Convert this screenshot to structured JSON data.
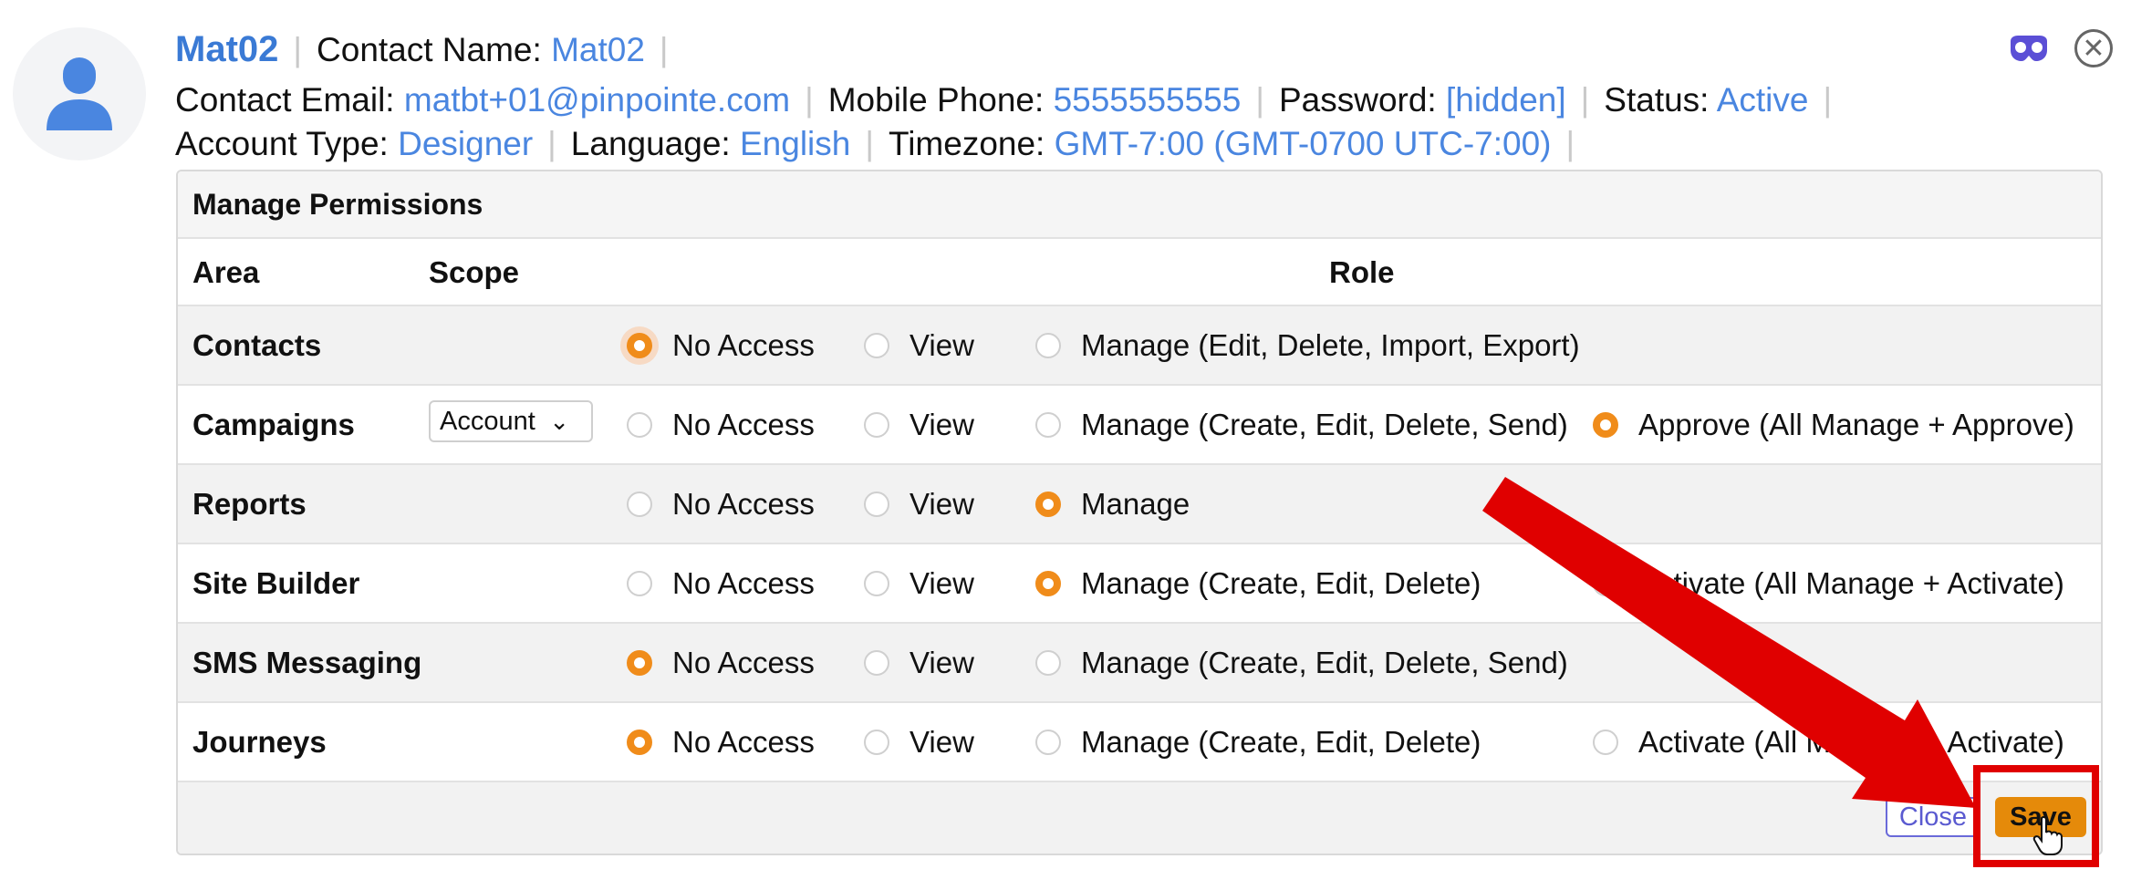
{
  "header": {
    "name": "Mat02",
    "separator": "|",
    "fields_line1": [
      {
        "label": "Contact Name:",
        "value": "Mat02"
      }
    ],
    "fields_line2": [
      {
        "label": "Contact Email:",
        "value": "matbt+01@pinpointe.com"
      },
      {
        "label": "Mobile Phone:",
        "value": "5555555555"
      },
      {
        "label": "Password:",
        "value": "[hidden]"
      },
      {
        "label": "Status:",
        "value": "Active"
      }
    ],
    "fields_line3": [
      {
        "label": "Account Type:",
        "value": "Designer"
      },
      {
        "label": "Language:",
        "value": "English"
      },
      {
        "label": "Timezone:",
        "value": "GMT-7:00 (GMT-0700 UTC-7:00)"
      }
    ],
    "close_glyph": "✕"
  },
  "permissions": {
    "title": "Manage Permissions",
    "columns": {
      "area": "Area",
      "scope": "Scope",
      "role": "Role"
    },
    "rows": [
      {
        "area": "Contacts",
        "options": [
          {
            "label": "No Access",
            "selected": true
          },
          {
            "label": "View",
            "selected": false
          },
          {
            "label": "Manage (Edit, Delete, Import, Export)",
            "selected": false
          }
        ]
      },
      {
        "area": "Campaigns",
        "scope": "Account",
        "options": [
          {
            "label": "No Access",
            "selected": false
          },
          {
            "label": "View",
            "selected": false
          },
          {
            "label": "Manage (Create, Edit, Delete, Send)",
            "selected": false
          },
          {
            "label": "Approve (All Manage + Approve)",
            "selected": true
          }
        ]
      },
      {
        "area": "Reports",
        "options": [
          {
            "label": "No Access",
            "selected": false
          },
          {
            "label": "View",
            "selected": false
          },
          {
            "label": "Manage",
            "selected": true
          }
        ]
      },
      {
        "area": "Site Builder",
        "options": [
          {
            "label": "No Access",
            "selected": false
          },
          {
            "label": "View",
            "selected": false
          },
          {
            "label": "Manage (Create, Edit, Delete)",
            "selected": true
          },
          {
            "label": "Activate (All Manage + Activate)",
            "selected": false
          }
        ]
      },
      {
        "area": "SMS Messaging",
        "options": [
          {
            "label": "No Access",
            "selected": true
          },
          {
            "label": "View",
            "selected": false
          },
          {
            "label": "Manage (Create, Edit, Delete, Send)",
            "selected": false
          }
        ]
      },
      {
        "area": "Journeys",
        "options": [
          {
            "label": "No Access",
            "selected": true
          },
          {
            "label": "View",
            "selected": false
          },
          {
            "label": "Manage (Create, Edit, Delete)",
            "selected": false
          },
          {
            "label": "Activate (All Manage + Activate)",
            "selected": false
          }
        ]
      }
    ]
  },
  "footer": {
    "close_label": "Close",
    "save_label": "Save"
  },
  "colors": {
    "accent": "#f08c1a",
    "link": "#4a86e0",
    "annotation": "#e00000"
  },
  "icons": [
    "user-avatar-icon",
    "mask-icon",
    "close-circle-icon",
    "chevron-down-icon",
    "hand-cursor-icon",
    "red-arrow-annotation"
  ]
}
